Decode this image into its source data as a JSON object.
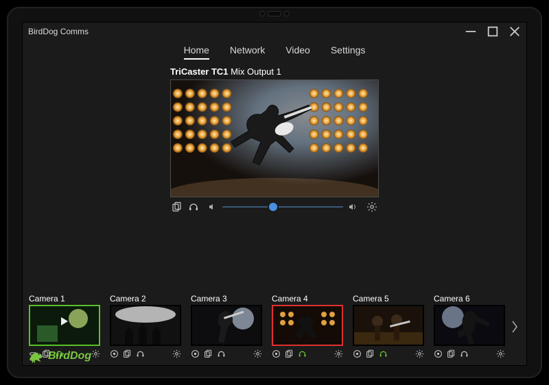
{
  "window": {
    "title": "BirdDog Comms"
  },
  "tabs": [
    {
      "label": "Home",
      "active": true
    },
    {
      "label": "Network",
      "active": false
    },
    {
      "label": "Video",
      "active": false
    },
    {
      "label": "Settings",
      "active": false
    }
  ],
  "source": {
    "device": "TriCaster TC1",
    "channel": "Mix Output 1",
    "volume": 0.42
  },
  "cameras": [
    {
      "label": "Camera 1",
      "border": "green",
      "headset": "green",
      "talk": false
    },
    {
      "label": "Camera 2",
      "border": "none",
      "headset": "plain",
      "talk": true
    },
    {
      "label": "Camera 3",
      "border": "none",
      "headset": "plain",
      "talk": true
    },
    {
      "label": "Camera 4",
      "border": "red",
      "headset": "green",
      "talk": true
    },
    {
      "label": "Camera 5",
      "border": "none",
      "headset": "green",
      "talk": true
    },
    {
      "label": "Camera 6",
      "border": "none",
      "headset": "plain",
      "talk": true
    }
  ],
  "brand": {
    "name": "BirdDog",
    "color": "#7ac642"
  }
}
